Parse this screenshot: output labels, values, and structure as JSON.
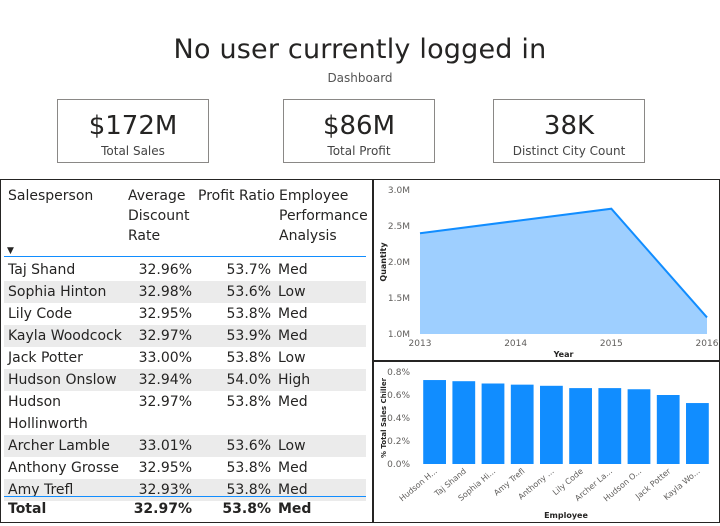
{
  "header": {
    "title": "No user currently logged in",
    "subtitle": "Dashboard"
  },
  "kpis": [
    {
      "value": "$172M",
      "label": "Total Sales"
    },
    {
      "value": "$86M",
      "label": "Total Profit"
    },
    {
      "value": "38K",
      "label": "Distinct City Count"
    }
  ],
  "table": {
    "columns": {
      "salesperson": "Salesperson",
      "discount_1": "Average",
      "discount_2": "Discount",
      "discount_3": "Rate",
      "profit_ratio": "Profit Ratio",
      "perf_1": "Employee",
      "perf_2": "Performance",
      "perf_3": "Analysis"
    },
    "sort_indicator": "▼",
    "rows": [
      {
        "name": "Taj Shand",
        "discount": "32.96%",
        "profit": "53.7%",
        "perf": "Med"
      },
      {
        "name": "Sophia Hinton",
        "discount": "32.98%",
        "profit": "53.6%",
        "perf": "Low"
      },
      {
        "name": "Lily Code",
        "discount": "32.95%",
        "profit": "53.8%",
        "perf": "Med"
      },
      {
        "name": "Kayla Woodcock",
        "discount": "32.97%",
        "profit": "53.9%",
        "perf": "Med"
      },
      {
        "name": "Jack Potter",
        "discount": "33.00%",
        "profit": "53.8%",
        "perf": "Low"
      },
      {
        "name": "Hudson Onslow",
        "discount": "32.94%",
        "profit": "54.0%",
        "perf": "High"
      },
      {
        "name": "Hudson",
        "name2": "Hollinworth",
        "discount": "32.97%",
        "profit": "53.8%",
        "perf": "Med"
      },
      {
        "name": "Archer Lamble",
        "discount": "33.01%",
        "profit": "53.6%",
        "perf": "Low"
      },
      {
        "name": "Anthony Grosse",
        "discount": "32.95%",
        "profit": "53.8%",
        "perf": "Med"
      },
      {
        "name": "Amy Trefl",
        "discount": "32.93%",
        "profit": "53.8%",
        "perf": "Med"
      }
    ],
    "total": {
      "name": "Total",
      "discount": "32.97%",
      "profit": "53.8%",
      "perf": "Med"
    }
  },
  "chart_data": [
    {
      "type": "area",
      "x": [
        2013,
        2014,
        2015,
        2016
      ],
      "values": [
        2.4,
        2.57,
        2.74,
        1.23
      ],
      "xlabel": "Year",
      "ylabel": "Quantity",
      "ylim": [
        1.0,
        3.0
      ],
      "y_ticks": [
        "1.0M",
        "1.5M",
        "2.0M",
        "2.5M",
        "3.0M"
      ],
      "x_ticks": [
        "2013",
        "2014",
        "2015",
        "2016"
      ],
      "color": "#9ecfff",
      "line_color": "#118dff"
    },
    {
      "type": "bar",
      "categories": [
        "Hudson H...",
        "Taj Shand",
        "Sophia Hi...",
        "Amy Trefl",
        "Anthony ...",
        "Lily Code",
        "Archer La...",
        "Hudson O...",
        "Jack Potter",
        "Kayla Wo..."
      ],
      "values": [
        0.73,
        0.72,
        0.7,
        0.69,
        0.68,
        0.66,
        0.66,
        0.65,
        0.6,
        0.53
      ],
      "xlabel": "Employee",
      "ylabel": "% Total Sales Chiller",
      "ylim": [
        0,
        0.8
      ],
      "y_ticks": [
        "0.0%",
        "0.2%",
        "0.4%",
        "0.6%",
        "0.8%"
      ],
      "color": "#118dff"
    }
  ]
}
